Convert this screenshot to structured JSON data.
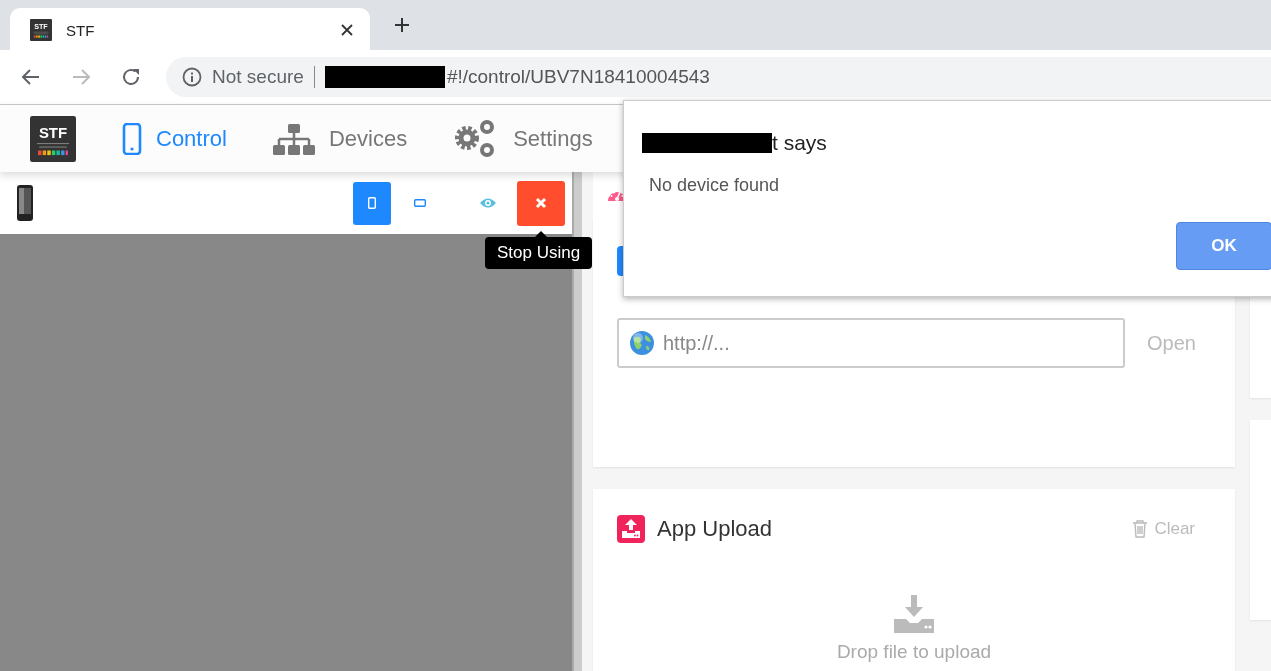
{
  "browser": {
    "tab": {
      "logo": "STF",
      "title": "STF"
    },
    "address": {
      "security": "Not secure",
      "url": "#!/control/UBV7N18410004543"
    }
  },
  "logo": "STF",
  "nav": [
    {
      "kind": "phone",
      "label": "Control",
      "selected": true
    },
    {
      "kind": "sitemap",
      "label": "Devices",
      "selected": false
    },
    {
      "kind": "gears",
      "label": "Settings",
      "selected": false
    }
  ],
  "device_toolbar": {
    "buttons": [
      {
        "kind": "portrait",
        "selected": true
      },
      {
        "kind": "landscape",
        "selected": false
      },
      {
        "kind": "eye"
      },
      {
        "kind": "stop"
      }
    ],
    "tooltip": "Stop Using"
  },
  "navigation_card": {
    "url_field": {
      "placeholder": "http://..."
    },
    "open_button": "Open"
  },
  "upload_card": {
    "title": "App Upload",
    "clear_button": "Clear",
    "drop_hint": "Drop file to upload"
  },
  "dialog": {
    "title": "t says",
    "message": "No device found",
    "button": "OK"
  }
}
